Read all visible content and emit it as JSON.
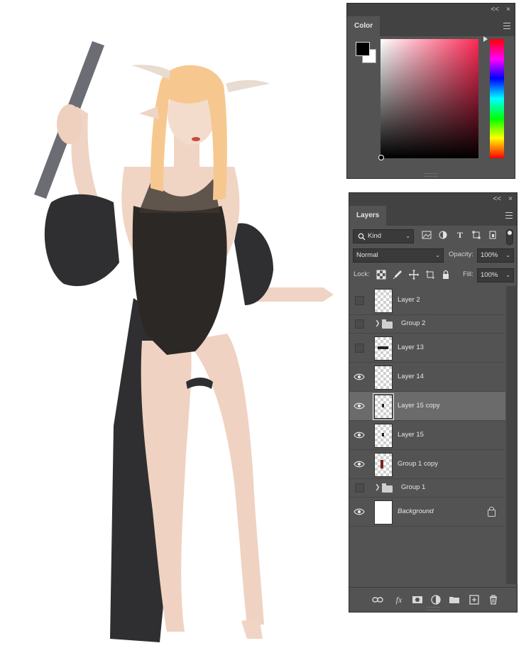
{
  "color_panel": {
    "tab_label": "Color",
    "collapse_glyph": "<<",
    "close_glyph": "×",
    "foreground_color": "#000000",
    "background_color": "#ffffff",
    "hue_color": "#ff2a55"
  },
  "layers_panel": {
    "tab_label": "Layers",
    "collapse_glyph": "<<",
    "close_glyph": "×",
    "filter": {
      "selected": "Kind"
    },
    "blend_mode": "Normal",
    "opacity_label": "Opacity:",
    "opacity_value": "100%",
    "lock_label": "Lock:",
    "fill_label": "Fill:",
    "fill_value": "100%",
    "layers": [
      {
        "name": "Layer 2",
        "type": "layer",
        "visible": false,
        "selected": false
      },
      {
        "name": "Group 2",
        "type": "group",
        "visible": false,
        "selected": false
      },
      {
        "name": "Layer 13",
        "type": "layer",
        "visible": false,
        "selected": false
      },
      {
        "name": "Layer 14",
        "type": "layer",
        "visible": true,
        "selected": false
      },
      {
        "name": "Layer 15 copy",
        "type": "layer",
        "visible": true,
        "selected": true
      },
      {
        "name": "Layer 15",
        "type": "layer",
        "visible": true,
        "selected": false
      },
      {
        "name": "Group 1 copy",
        "type": "layer",
        "visible": true,
        "selected": false
      },
      {
        "name": "Group 1",
        "type": "group",
        "visible": false,
        "selected": false
      },
      {
        "name": "Background",
        "type": "background",
        "visible": true,
        "selected": false,
        "locked": true
      }
    ],
    "bottom_icons": [
      "link-icon",
      "fx-icon",
      "mask-icon",
      "adjustment-icon",
      "folder-icon",
      "new-layer-icon",
      "trash-icon"
    ],
    "fx_label": "fx"
  }
}
